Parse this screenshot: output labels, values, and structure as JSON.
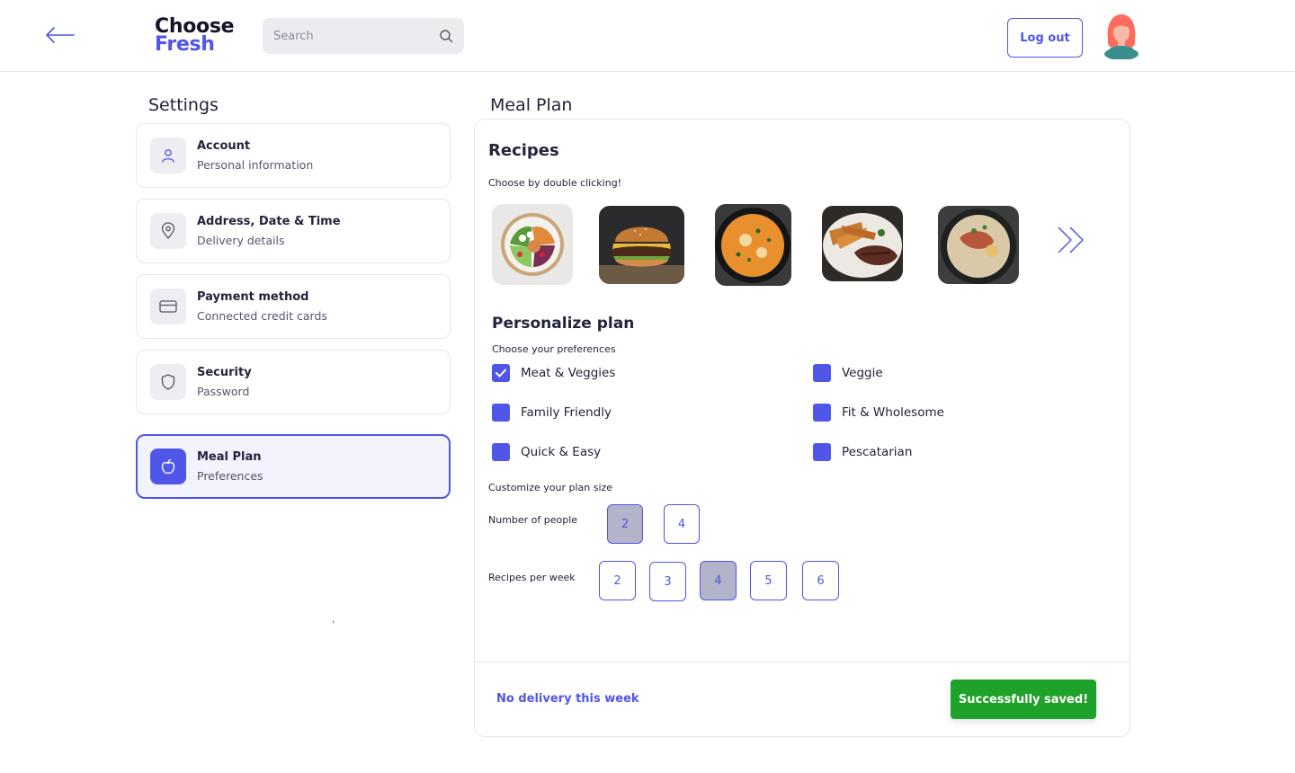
{
  "header": {
    "logo_line1": "Choose",
    "logo_line2": "Fresh",
    "search_placeholder": "Search",
    "logout_label": "Log out",
    "accent_color": "#5056e8"
  },
  "settings": {
    "title": "Settings",
    "items": [
      {
        "title": "Account",
        "subtitle": "Personal information",
        "icon": "user-icon"
      },
      {
        "title": "Address, Date & Time",
        "subtitle": "Delivery details",
        "icon": "location-pin-icon"
      },
      {
        "title": "Payment method",
        "subtitle": "Connected credit cards",
        "icon": "credit-card-icon"
      },
      {
        "title": "Security",
        "subtitle": "Password",
        "icon": "shield-icon"
      },
      {
        "title": "Meal Plan",
        "subtitle": "Preferences",
        "icon": "apple-icon",
        "active": true
      }
    ],
    "stray_mark": ","
  },
  "meal_plan": {
    "title": "Meal Plan",
    "recipes": {
      "title": "Recipes",
      "hint": "Choose by double clicking!",
      "images": [
        "salad-bowl",
        "burger",
        "curry-pan",
        "steak-and-fries",
        "soup-bowl"
      ]
    },
    "personalize": {
      "title": "Personalize plan",
      "hint": "Choose your preferences",
      "preferences": [
        {
          "label": "Meat & Veggies",
          "checked": true
        },
        {
          "label": "Veggie",
          "checked": false
        },
        {
          "label": "Family Friendly",
          "checked": false
        },
        {
          "label": "Fit & Wholesome",
          "checked": false
        },
        {
          "label": "Quick & Easy",
          "checked": false
        },
        {
          "label": "Pescatarian",
          "checked": false
        }
      ]
    },
    "plan_size": {
      "hint": "Customize your plan size",
      "people_label": "Number of people",
      "people_options": [
        "2",
        "4"
      ],
      "people_selected": "2",
      "recipes_label": "Recipes per week",
      "recipes_options": [
        "2",
        "3",
        "4",
        "5",
        "6"
      ],
      "recipes_selected": "4"
    },
    "footer": {
      "no_delivery_label": "No delivery this week",
      "saved_label": "Successfully saved!",
      "saved_color": "#1fa22a"
    }
  }
}
